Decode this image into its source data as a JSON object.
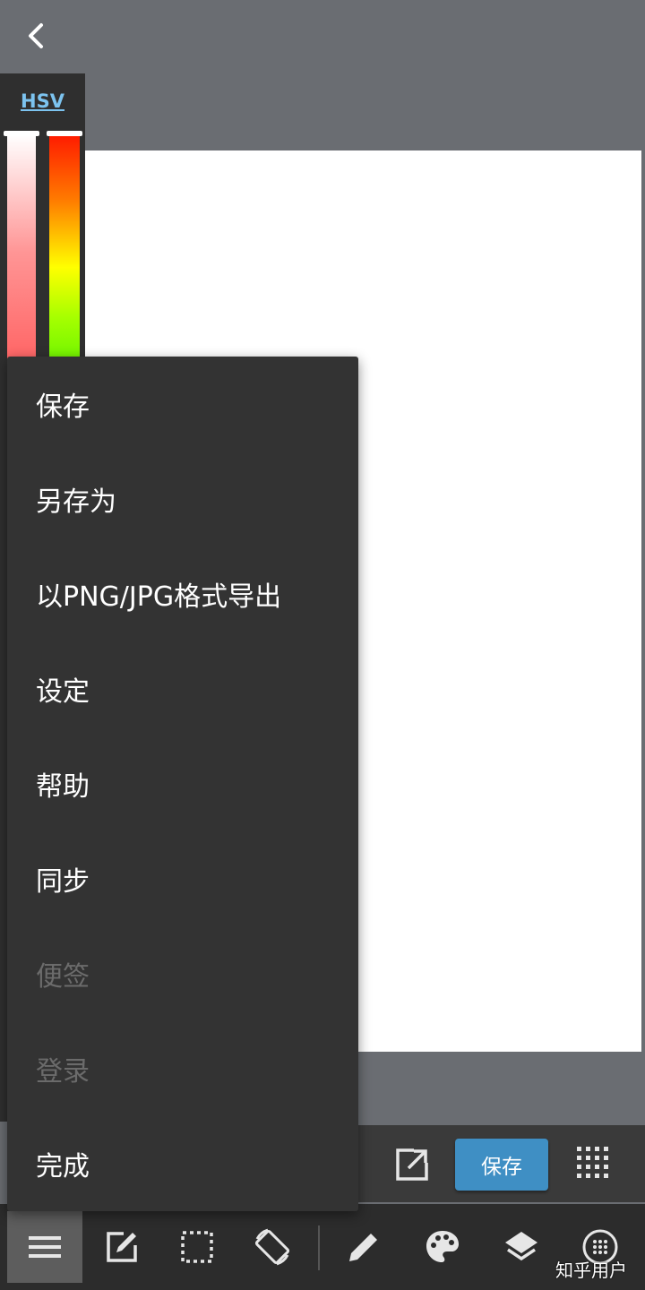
{
  "color_panel": {
    "tab_label": "HSV"
  },
  "menu": {
    "items": [
      {
        "label": "保存",
        "enabled": true
      },
      {
        "label": "另存为",
        "enabled": true
      },
      {
        "label": "以PNG/JPG格式导出",
        "enabled": true
      },
      {
        "label": "设定",
        "enabled": true
      },
      {
        "label": "帮助",
        "enabled": true
      },
      {
        "label": "同步",
        "enabled": true
      },
      {
        "label": "便签",
        "enabled": false
      },
      {
        "label": "登录",
        "enabled": false
      },
      {
        "label": "完成",
        "enabled": true
      }
    ]
  },
  "action_bar": {
    "save_label": "保存"
  },
  "toolbar": {
    "tools": [
      "menu-icon",
      "edit-icon",
      "select-icon",
      "rotate-icon",
      "pencil-icon",
      "palette-icon",
      "layers-icon",
      "grid-dots-icon"
    ]
  },
  "watermark": "知乎用户",
  "colors": {
    "accent": "#3f8fc4",
    "menu_bg": "#333333",
    "toolbar_bg": "#2c2c2c"
  }
}
